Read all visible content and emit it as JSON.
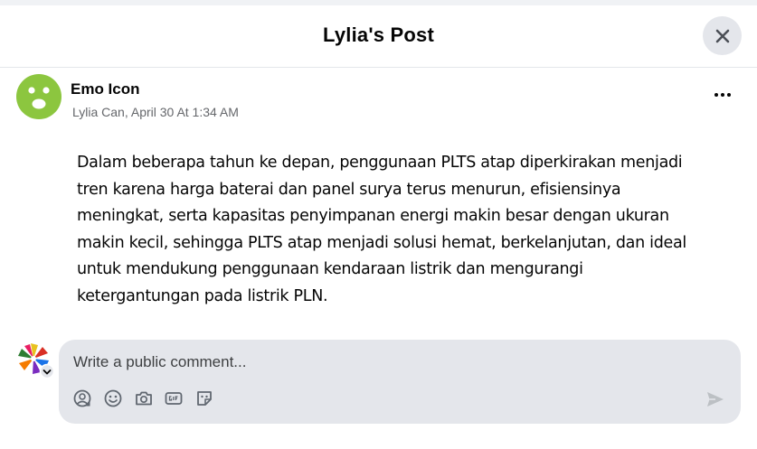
{
  "header": {
    "title": "Lylia's Post",
    "close_icon": "close-icon"
  },
  "post": {
    "author_name": "Emo Icon",
    "meta": "Lylia Can, April 30 At 1:34 AM",
    "body": "Dalam beberapa tahun ke depan, penggunaan PLTS atap diperkirakan menjadi tren karena harga baterai dan panel surya terus menurun, efisiensinya meningkat, serta kapasitas penyimpanan energi makin besar dengan ukuran makin kecil, sehingga PLTS atap menjadi solusi hemat, berkelanjutan, dan ideal untuk mendukung penggunaan kendaraan listrik dan mengurangi ketergantungan pada listrik PLN.",
    "avatar_color": "#8cc63f",
    "more_icon": "more-horizontal-icon"
  },
  "comment": {
    "placeholder": "Write a public comment...",
    "tools": [
      "avatar-sticker-icon",
      "emoji-icon",
      "camera-icon",
      "gif-icon",
      "sticker-icon"
    ],
    "send_icon": "send-icon"
  },
  "colors": {
    "box": "#e4e6eb",
    "muted": "#65676b",
    "icon": "#606770"
  }
}
